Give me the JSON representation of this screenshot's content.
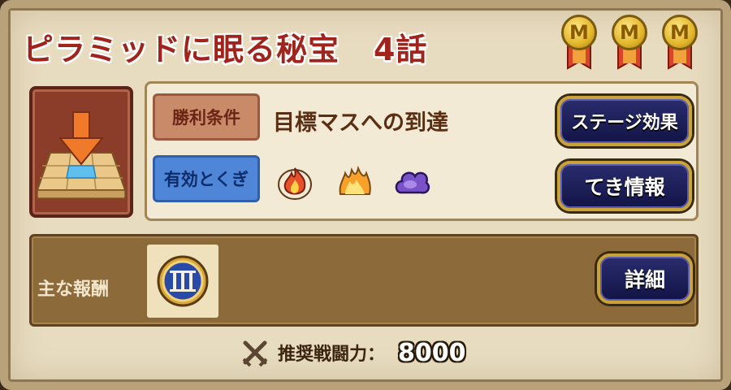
{
  "stage": {
    "title": "ピラミッドに眠る秘宝",
    "episode": "4話"
  },
  "medals": [
    {
      "letter": "M",
      "icon": "medal-icon"
    },
    {
      "letter": "M",
      "icon": "medal-icon"
    },
    {
      "letter": "M",
      "icon": "medal-icon"
    }
  ],
  "goal_tile": {
    "icon": "goal-arrow-tile-icon"
  },
  "conditions": {
    "victory_label": "勝利条件",
    "victory_text": "目標マスへの到達",
    "effective_label": "有効とくぎ",
    "effective_icons": [
      "fire-icon",
      "flame-icon",
      "dark-cloud-icon"
    ]
  },
  "buttons": {
    "stage_effect": "ステージ効果",
    "enemy_info": "てき情報",
    "details": "詳細"
  },
  "reward": {
    "label": "主な報酬",
    "item_icon": "roman-numeral-iii-coin-icon"
  },
  "power": {
    "label": "推奨戦闘力：",
    "value": "8000",
    "icon": "crossed-swords-icon"
  },
  "colors": {
    "title": "#a0241b",
    "victory_label_bg": "#c98a6a",
    "effective_label_bg": "#4f86d8",
    "button_bg": "#1f2160",
    "button_border": "#c9a23a",
    "reward_bar_bg": "#8d6a3a"
  }
}
